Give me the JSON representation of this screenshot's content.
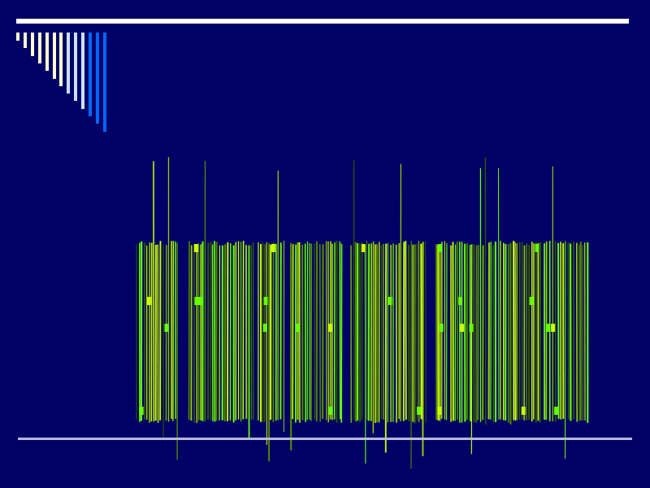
{
  "slide": {
    "background_color": "#000066",
    "rule_color": "#ffffff",
    "bottom_rule_color": "#b8b8d8",
    "text_color_primary": "#66ff00",
    "text_color_secondary": "#ccff00",
    "text_color_dark": "#335500"
  },
  "decoration": {
    "bar_colors": [
      "#ffffcc",
      "#ffffcc",
      "#ffffcc",
      "#ffffcc",
      "#ffffcc",
      "#ffffcc",
      "#ffffcc",
      "#cce0ff",
      "#cce0ff",
      "#cce0ff",
      "#0066ff",
      "#0066ff",
      "#0066ff"
    ]
  }
}
